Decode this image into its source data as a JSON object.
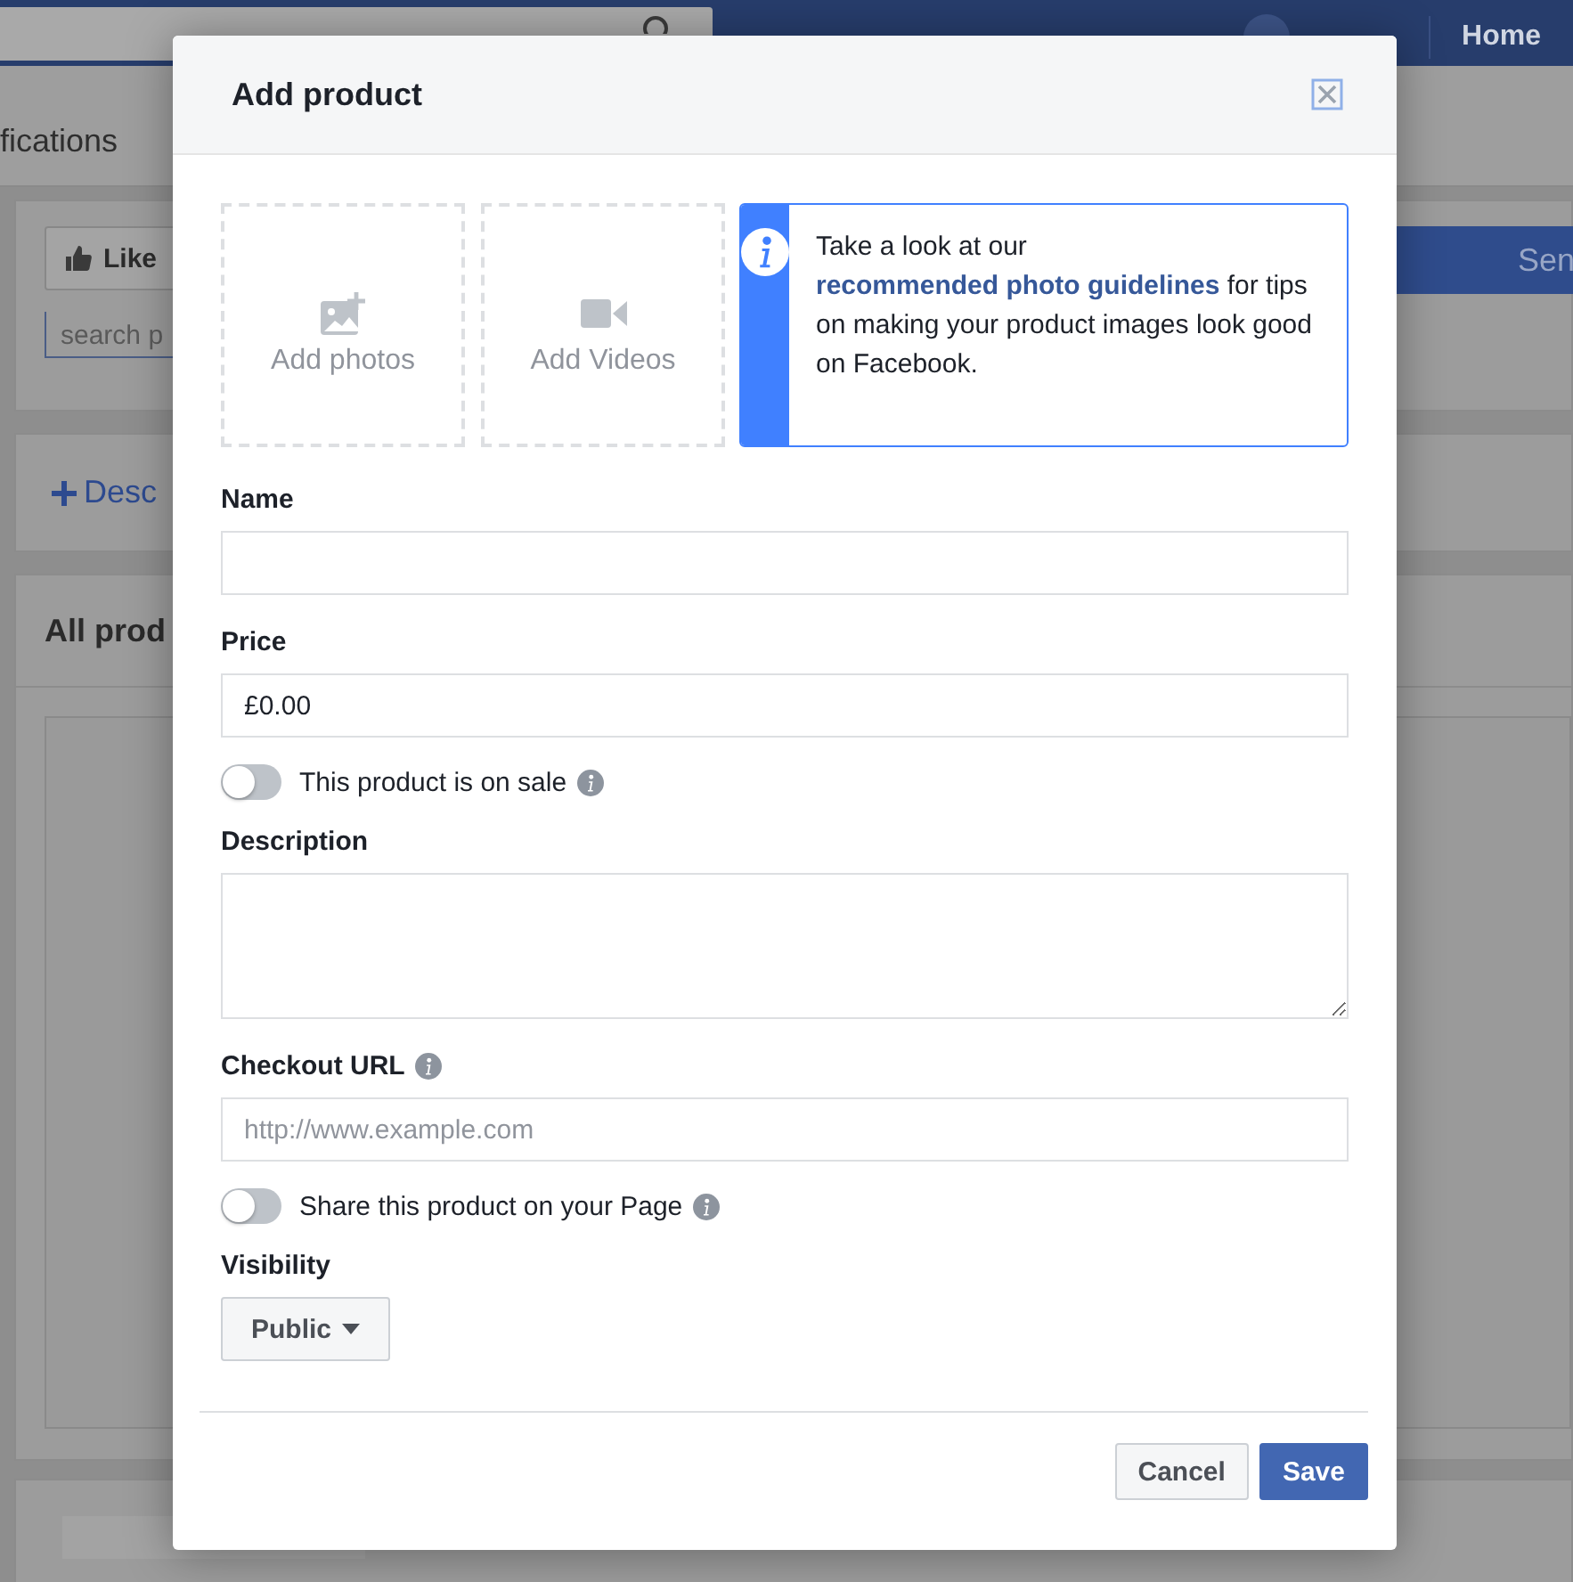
{
  "background": {
    "home_link": "Home",
    "nav_tab": "fications",
    "like_button": "Like",
    "search_placeholder": "search p",
    "send_button": "Sen",
    "describe_link": "Desc",
    "all_products_heading": "All prod"
  },
  "dialog": {
    "title": "Add product",
    "media_tiles": [
      {
        "kind": "photo",
        "label": "Add photos"
      },
      {
        "kind": "video",
        "label": "Add Videos"
      }
    ],
    "tip": {
      "text_before": "Take a look at our",
      "link": "recommended photo guidelines",
      "text_after": "for tips on making your product images look good on Facebook."
    },
    "fields": [
      {
        "kind": "text",
        "label": "Name"
      },
      {
        "kind": "text",
        "label": "Price",
        "value": "£0.00"
      },
      {
        "kind": "toggle",
        "label": "This product is on sale",
        "on": false,
        "info": true
      },
      {
        "kind": "textarea",
        "label": "Description"
      },
      {
        "kind": "text",
        "label": "Checkout URL",
        "info": true,
        "placeholder": "http://www.example.com"
      },
      {
        "kind": "toggle",
        "label": "Share this product on your Page",
        "on": false,
        "info": true
      },
      {
        "kind": "select",
        "label": "Visibility",
        "value": "Public"
      }
    ],
    "buttons": [
      {
        "kind": "secondary",
        "label": "Cancel"
      },
      {
        "kind": "primary",
        "label": "Save"
      }
    ]
  }
}
